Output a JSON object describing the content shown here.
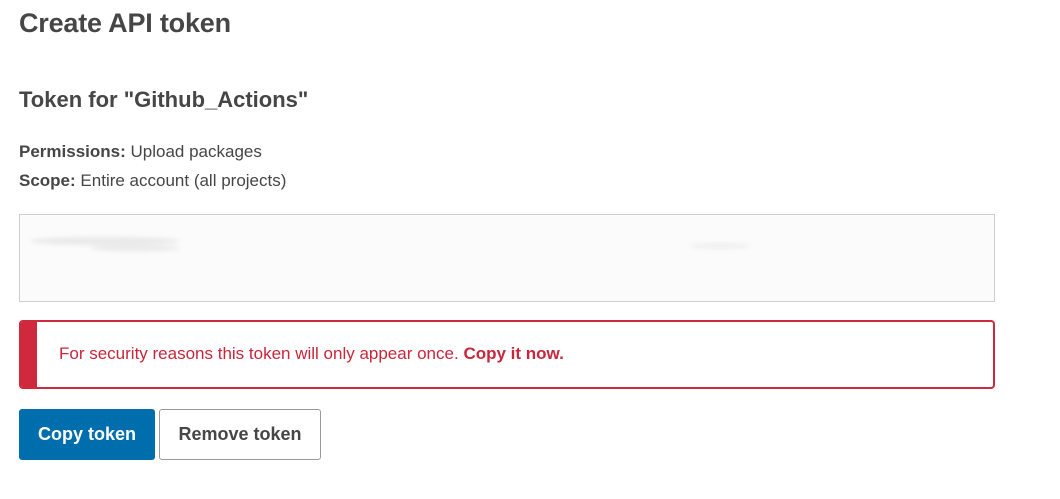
{
  "page": {
    "title": "Create API token"
  },
  "token_section": {
    "heading": "Token for \"Github_Actions\"",
    "permissions_label": "Permissions:",
    "permissions_value": "Upload packages",
    "scope_label": "Scope:",
    "scope_value": "Entire account (all projects)"
  },
  "alert": {
    "message": "For security reasons this token will only appear once.",
    "emphasis": "Copy it now.",
    "color": "#d0283c"
  },
  "actions": {
    "copy_label": "Copy token",
    "remove_label": "Remove token",
    "primary_color": "#006dad"
  }
}
